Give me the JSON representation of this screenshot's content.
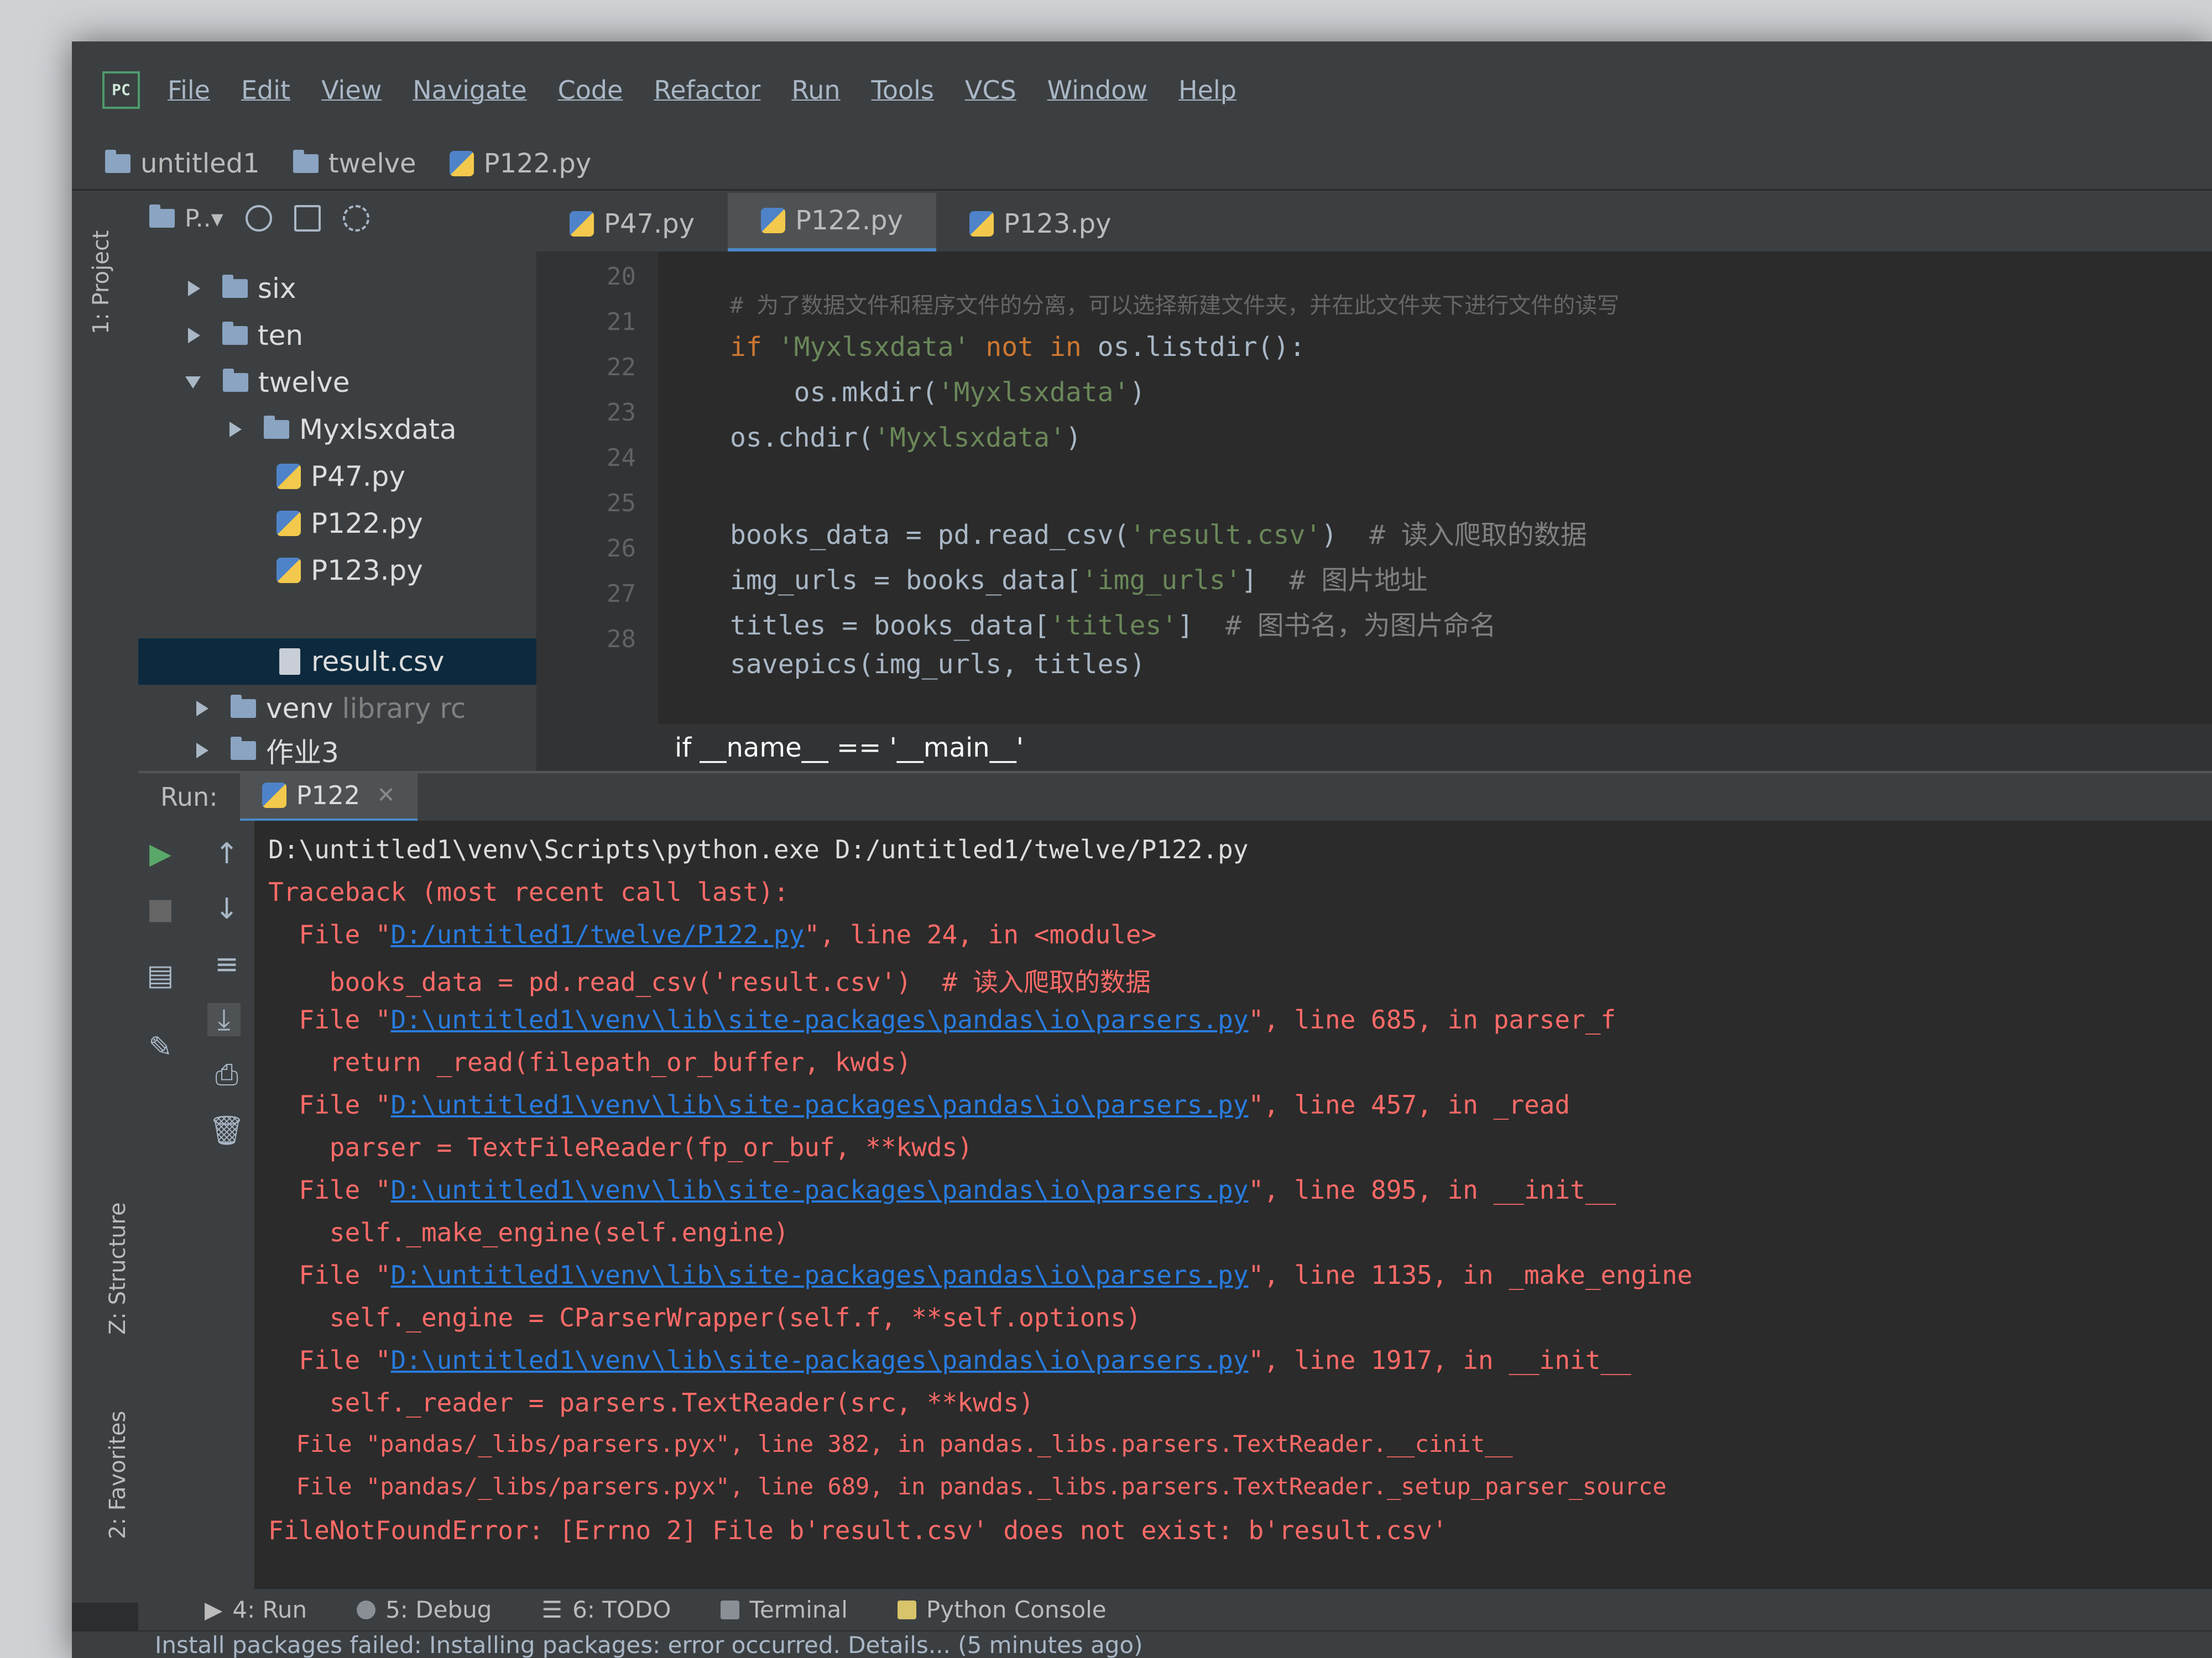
{
  "menu": {
    "logo": "PC",
    "items": [
      "File",
      "Edit",
      "View",
      "Navigate",
      "Code",
      "Refactor",
      "Run",
      "Tools",
      "VCS",
      "Window",
      "Help"
    ]
  },
  "breadcrumbs": [
    "untitled1",
    "twelve",
    "P122.py"
  ],
  "side_strip": {
    "project": "1: Project",
    "structure": "Z: Structure",
    "favorites": "2: Favorites"
  },
  "project_toolbar": {
    "label": "P..▾"
  },
  "tree": [
    {
      "name": "six",
      "type": "folder",
      "expanded": false
    },
    {
      "name": "ten",
      "type": "folder",
      "expanded": false
    },
    {
      "name": "twelve",
      "type": "folder",
      "expanded": true
    },
    {
      "name": "Myxlsxdata",
      "type": "folder",
      "expanded": false
    },
    {
      "name": "P47.py",
      "type": "py"
    },
    {
      "name": "P122.py",
      "type": "py"
    },
    {
      "name": "P123.py",
      "type": "py"
    },
    {
      "name": "result.csv",
      "type": "csv"
    },
    {
      "name": "venv",
      "suffix": "library rc",
      "type": "folder",
      "expanded": false
    },
    {
      "name": "作业3",
      "type": "folder",
      "expanded": false
    }
  ],
  "editor_tabs": [
    {
      "label": "P47.py",
      "active": false
    },
    {
      "label": "P122.py",
      "active": true
    },
    {
      "label": "P123.py",
      "active": false
    }
  ],
  "line_numbers": [
    "20",
    "21",
    "22",
    "23",
    "24",
    "25",
    "26",
    "27",
    "28"
  ],
  "code": {
    "l19_comment": "# 为了数据文件和程序文件的分离，可以选择新建文件夹，并在此文件夹下进行文件的读写",
    "l20_if": "if",
    "l20_str": " 'Myxlsxdata' ",
    "l20_kw": "not in",
    "l20_rest": " os.listdir():",
    "l21_a": "    os.mkdir(",
    "l21_str": "'Myxlsxdata'",
    "l21_b": ")",
    "l22_a": "os.chdir(",
    "l22_str": "'Myxlsxdata'",
    "l22_b": ")",
    "l24_a": "books_data = pd.read_csv(",
    "l24_str": "'result.csv'",
    "l24_b": ")  ",
    "l24_cm": "# 读入爬取的数据",
    "l25_a": "img_urls = books_data[",
    "l25_str": "'img_urls'",
    "l25_b": "]  ",
    "l25_cm": "# 图片地址",
    "l26_a": "titles = books_data[",
    "l26_str": "'titles'",
    "l26_b": "]  ",
    "l26_cm": "# 图书名，为图片命名",
    "l27": "savepics(img_urls, titles)"
  },
  "breadcrumb_hint": "if __name__ == '__main__'",
  "run": {
    "label": "Run:",
    "tab": "P122"
  },
  "console": {
    "cmd": "D:\\untitled1\\venv\\Scripts\\python.exe D:/untitled1/twelve/P122.py",
    "traceback": "Traceback (most recent call last):",
    "f1_pre": "  File \"",
    "f1_link": "D:/untitled1/twelve/P122.py",
    "f1_post": "\", line 24, in <module>",
    "f1_code": "    books_data = pd.read_csv('result.csv')  # 读入爬取的数据",
    "f2_pre": "  File \"",
    "f2_link": "D:\\untitled1\\venv\\lib\\site-packages\\pandas\\io\\parsers.py",
    "f2_post": "\", line 685, in parser_f",
    "f2_code": "    return _read(filepath_or_buffer, kwds)",
    "f3_pre": "  File \"",
    "f3_link": "D:\\untitled1\\venv\\lib\\site-packages\\pandas\\io\\parsers.py",
    "f3_post": "\", line 457, in _read",
    "f3_code": "    parser = TextFileReader(fp_or_buf, **kwds)",
    "f4_pre": "  File \"",
    "f4_link": "D:\\untitled1\\venv\\lib\\site-packages\\pandas\\io\\parsers.py",
    "f4_post": "\", line 895, in __init__",
    "f4_code": "    self._make_engine(self.engine)",
    "f5_pre": "  File \"",
    "f5_link": "D:\\untitled1\\venv\\lib\\site-packages\\pandas\\io\\parsers.py",
    "f5_post": "\", line 1135, in _make_engine",
    "f5_code": "    self._engine = CParserWrapper(self.f, **self.options)",
    "f6_pre": "  File \"",
    "f6_link": "D:\\untitled1\\venv\\lib\\site-packages\\pandas\\io\\parsers.py",
    "f6_post": "\", line 1917, in __init__",
    "f6_code": "    self._reader = parsers.TextReader(src, **kwds)",
    "f7": "  File \"pandas/_libs/parsers.pyx\", line 382, in pandas._libs.parsers.TextReader.__cinit__",
    "f8": "  File \"pandas/_libs/parsers.pyx\", line 689, in pandas._libs.parsers.TextReader._setup_parser_source",
    "error": "FileNotFoundError: [Errno 2] File b'result.csv' does not exist: b'result.csv'"
  },
  "bottom_tabs": [
    "4: Run",
    "5: Debug",
    "6: TODO",
    "Terminal",
    "Python Console"
  ],
  "status": "Install packages failed: Installing packages: error occurred. Details... (5 minutes ago)"
}
